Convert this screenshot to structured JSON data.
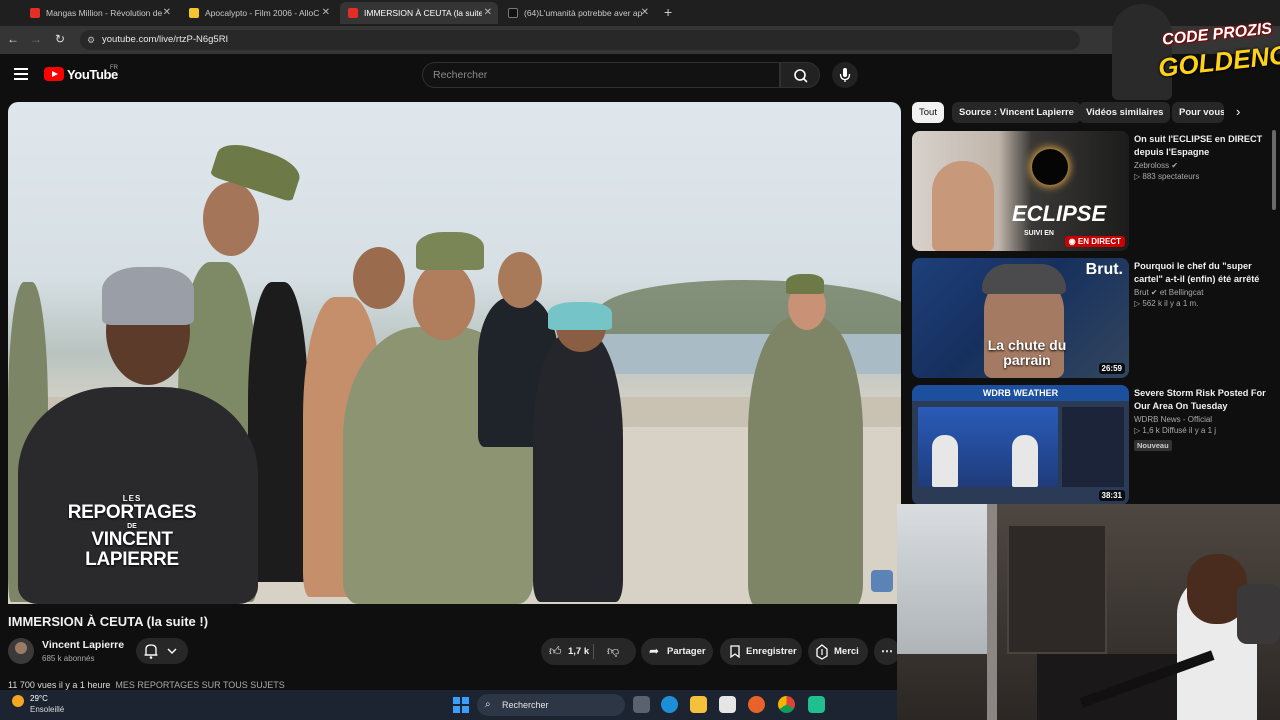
{
  "tabs": [
    {
      "title": "Mangas Million - Révolution de",
      "color": "#e52d27",
      "active": false
    },
    {
      "title": "Apocalypto - Film 2006 - AlloC",
      "color": "#f4c430",
      "active": false
    },
    {
      "title": "IMMERSION À CEUTA (la suite !)",
      "color": "#e52d27",
      "active": true
    },
    {
      "title": "(64)L'umanità potrebbe aver ap",
      "color": "#ffffff",
      "active": false
    }
  ],
  "address": {
    "url": "youtube.com/live/rtzP-N6g5RI"
  },
  "youtube": {
    "logo_text": "YouTube",
    "country": "FR",
    "search_placeholder": "Rechercher"
  },
  "video": {
    "overlay_line1": "LES",
    "overlay_line2": "REPORTAGES",
    "overlay_line3": "DE",
    "overlay_line4": "VINCENT LAPIERRE",
    "title": "IMMERSION À CEUTA (la suite !)",
    "channel": "Vincent Lapierre",
    "subscribers": "685 k abonnés",
    "likes": "1,7 k",
    "share": "Partager",
    "save": "Enregistrer",
    "thanks": "Merci",
    "description_stats": "11 700 vues  il y a 1 heure",
    "description_link": "MES REPORTAGES SUR TOUS SUJETS"
  },
  "chips": [
    "Tout",
    "Source : Vincent Lapierre",
    "Vidéos similaires",
    "Pour vous"
  ],
  "recommendations": [
    {
      "title": "On suit l'ECLIPSE en DIRECT depuis l'Espagne",
      "channel": "Zebroloss",
      "stats": "883 spectateurs",
      "thumb_text": "ECLIPSE",
      "thumb_sub": "SUIVI EN",
      "live_label": "EN DIRECT",
      "duration": "",
      "badge": ""
    },
    {
      "title": "Pourquoi le chef du \"super cartel\" a-t-il (enfin) été arrêté",
      "channel": "Brut",
      "channel_extra": "et Bellingcat",
      "stats": "562 k  il y a 1 m.",
      "thumb_text": "La chute du parrain",
      "thumb_brand": "Brut.",
      "duration": "26:59",
      "badge": ""
    },
    {
      "title": "Severe Storm Risk Posted For Our Area On Tuesday",
      "channel": "WDRB News - Official",
      "stats": "1,6 k  Diffusé il y a 1 j",
      "thumb_text": "WDRB WEATHER",
      "duration": "38:31",
      "badge": "Nouveau"
    }
  ],
  "taskbar": {
    "temperature": "29°C",
    "condition": "Ensoleillé",
    "search": "Rechercher"
  },
  "stream_overlay": {
    "line1": "CODE PROZIS",
    "line2": "GOLDENG"
  },
  "colors": {
    "yt_red": "#ff0000",
    "bg": "#0f0f0f",
    "taskbar": "#1c2431"
  }
}
